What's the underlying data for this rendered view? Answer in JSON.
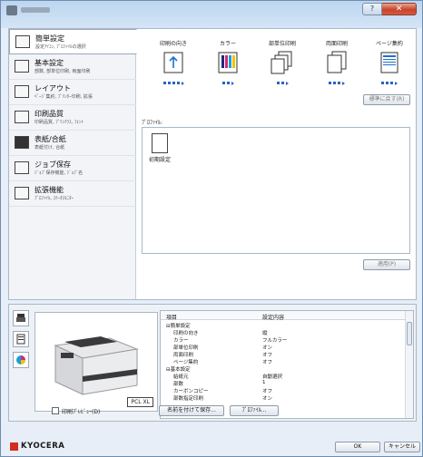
{
  "window": {
    "title": "",
    "help_label": "?",
    "close_label": "✕"
  },
  "nav": [
    {
      "title": "簡単設定",
      "sub": "設定ｱｲｺﾝ, ﾌﾟﾛﾌｧｲﾙの選択"
    },
    {
      "title": "基本設定",
      "sub": "部数, 部単位印刷, 両面印刷"
    },
    {
      "title": "レイアウト",
      "sub": "ﾍﾟｰｼﾞ集約, ﾌﾟﾘﾝﾀｰ印刷, 拡張"
    },
    {
      "title": "印刷品質",
      "sub": "印刷品質, ﾌﾟﾘﾝｸﾗｽ, ﾌｫﾝﾄ"
    },
    {
      "title": "表紙/合紙",
      "sub": "表紙付け, 合紙"
    },
    {
      "title": "ジョブ保存",
      "sub": "ｼﾞｮﾌﾞ保存機能, ｼﾞｮﾌﾞ名"
    },
    {
      "title": "拡張機能",
      "sub": "ﾌﾟﾛﾌｧｲﾙ, ｽﾃｰﾀｽﾓﾆﾀｰ"
    }
  ],
  "presets": {
    "headers": [
      "印刷の向き",
      "カラー",
      "部単位印刷",
      "両面印刷",
      "ページ集約"
    ]
  },
  "buttons": {
    "reset": "標準に戻す(R)",
    "apply": "適用(P)",
    "save_as": "名前を付けて保存...",
    "profile": "ﾌﾟﾛﾌｧｲﾙ...",
    "ok": "OK",
    "cancel": "キャンセル"
  },
  "profile": {
    "label": "ﾌﾟﾛﾌｧｲﾙ:",
    "item": "初期設定"
  },
  "preview": {
    "badge": "PCL XL"
  },
  "summary": {
    "col_item": "項目",
    "col_value": "設定内容",
    "rows": [
      {
        "k": "⊟簡単設定",
        "v": "",
        "indent": 0
      },
      {
        "k": "印刷の向き",
        "v": "縦",
        "indent": 1
      },
      {
        "k": "カラー",
        "v": "フルカラー",
        "indent": 1
      },
      {
        "k": "部単位印刷",
        "v": "オン",
        "indent": 1
      },
      {
        "k": "両面印刷",
        "v": "オフ",
        "indent": 1
      },
      {
        "k": "ページ集約",
        "v": "オフ",
        "indent": 1
      },
      {
        "k": "⊟基本設定",
        "v": "",
        "indent": 0
      },
      {
        "k": "給紙元",
        "v": "自動選択",
        "indent": 1
      },
      {
        "k": "部数",
        "v": "1",
        "indent": 1
      },
      {
        "k": "カーボンコピー",
        "v": "オフ",
        "indent": 1
      },
      {
        "k": "部数指定印刷",
        "v": "オン",
        "indent": 1
      }
    ]
  },
  "print_preview_label": "印刷ﾌﾟﾚﾋﾞｭｰ(D)",
  "brand": "KYOCERA"
}
